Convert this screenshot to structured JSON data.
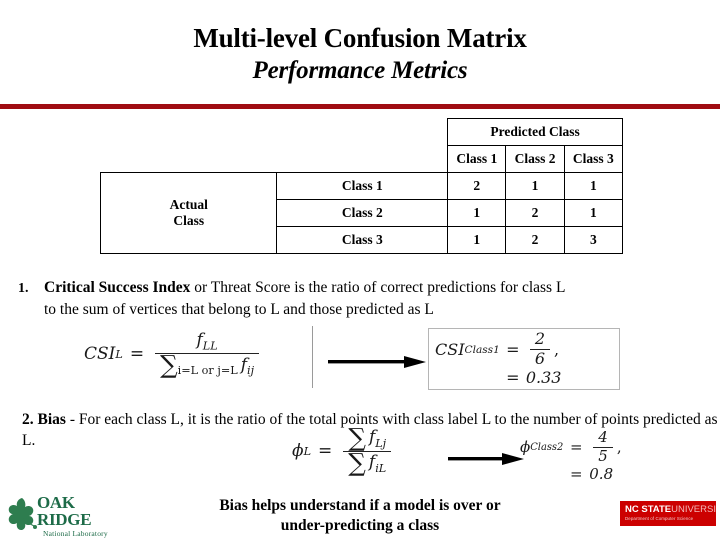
{
  "slide": {
    "title_line1": "Multi-level Confusion Matrix",
    "title_line2": "Performance Metrics",
    "rule_color": "#a00c12"
  },
  "matrix": {
    "predicted_header": "Predicted Class",
    "actual_header": "Actual Class",
    "actual_header_line1": "Actual",
    "actual_header_line2": "Class",
    "column_headers": [
      "Class 1",
      "Class 2",
      "Class 3"
    ],
    "row_headers": [
      "Class 1",
      "Class 2",
      "Class 3"
    ],
    "rows": [
      {
        "label": "Class 1",
        "values": [
          "2",
          "1",
          "1"
        ]
      },
      {
        "label": "Class 2",
        "values": [
          "1",
          "2",
          "1"
        ]
      },
      {
        "label": "Class 3",
        "values": [
          "1",
          "2",
          "3"
        ]
      }
    ]
  },
  "item1": {
    "number": "1.",
    "bold_lead": "Critical Success Index",
    "rest_line1": " or Threat Score is the ratio of correct predictions for class L",
    "line2": "to the sum of vertices that belong to L and those predicted as L"
  },
  "item2": {
    "number": "2. ",
    "bold_lead": "Bias",
    "rest": " - For each class L, it is the ratio of the total points with class label L to the number of points predicted as L."
  },
  "csi_formula": {
    "lhs_symbol": "CSI",
    "lhs_superscript": "L",
    "equals": "=",
    "numerator_base": "f",
    "numerator_sub": "LL",
    "denominator_sigma": "∑",
    "denominator_sigma_sub": "i=L or j=L",
    "denominator_base": "f",
    "denominator_sub": "ij",
    "arrow": "arrow-right"
  },
  "csi_result": {
    "symbol": "CSI",
    "superscript": "Class1",
    "eq1": "=",
    "numerator": "2",
    "denominator": "6",
    "comma": ",",
    "eq2": "=",
    "value": "0.33"
  },
  "bias_formula": {
    "lhs_symbol": "ϕ",
    "lhs_superscript": "L",
    "equals": "=",
    "numerator_sigma": "∑",
    "numerator_base": "f",
    "numerator_sub": "Lj",
    "denominator_sigma": "∑",
    "denominator_base": "f",
    "denominator_sub": "iL",
    "arrow": "arrow-right"
  },
  "bias_result": {
    "symbol": "ϕ",
    "superscript": "Class2",
    "eq1": "=",
    "numerator": "4",
    "denominator": "5",
    "comma": ",",
    "eq2": "=",
    "value": "0.8"
  },
  "bottom_caption": {
    "line1": "Bias helps understand if a model is over or",
    "line2": "under-predicting a class"
  },
  "ornl_logo": {
    "oak": "OAK",
    "ridge": "RIDGE",
    "national_laboratory": "National Laboratory",
    "color": "#1d6b48"
  },
  "ncstate_logo": {
    "nc_state": "NC STATE",
    "university": "UNIVERSITY",
    "tagline": "Department of Computer Science",
    "color": "#cc0000"
  }
}
